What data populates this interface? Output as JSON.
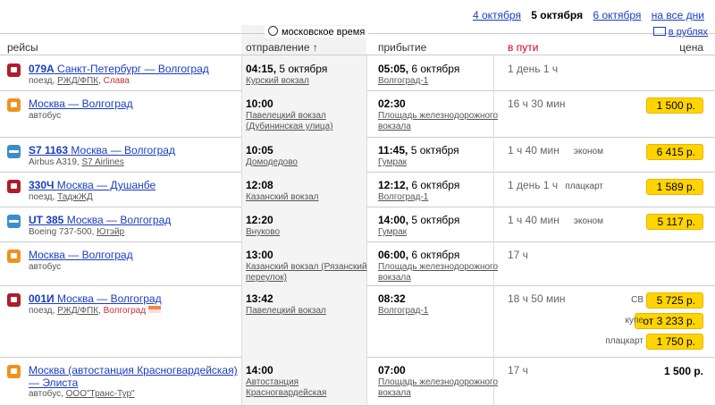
{
  "dates": {
    "prev": "4 октября",
    "current": "5 октября",
    "next": "6 октября",
    "all": "на все дни"
  },
  "header": {
    "moscow_time": "московское время",
    "currency": "в рублях",
    "col_route": "рейсы",
    "col_departure": "отправление ↑",
    "col_arrival": "прибытие",
    "col_duration": "в пути",
    "col_price": "цена"
  },
  "rows": [
    {
      "type": "train",
      "number": "079А",
      "route": "Санкт-Петербург — Волгоград",
      "kind": "поезд,",
      "carrier": "РЖД/ФПК",
      "brand": "Слава",
      "dep_time": "04:15",
      "dep_date": "5 октября",
      "dep_station": "Курский вокзал",
      "arr_time": "05:05",
      "arr_date": "6 октября",
      "arr_station": "Волгоград-1",
      "duration": "1 день 1 ч",
      "prices": []
    },
    {
      "type": "bus",
      "number": "",
      "route": "Москва — Волгоград",
      "kind": "автобус",
      "carrier": "",
      "brand": "",
      "dep_time": "10:00",
      "dep_date": "",
      "dep_station": "Павелецкий вокзал (Дубининская улица)",
      "arr_time": "02:30",
      "arr_date": "",
      "arr_station": "Площадь железнодорожного вокзала",
      "duration": "16 ч 30 мин",
      "prices": [
        {
          "class": "",
          "value": "1 500 р."
        }
      ]
    },
    {
      "type": "plane",
      "number": "S7 1163",
      "route": "Москва — Волгоград",
      "kind": "Airbus A319,",
      "carrier": "S7 Airlines",
      "brand": "",
      "dep_time": "10:05",
      "dep_date": "",
      "dep_station": "Домодедово",
      "arr_time": "11:45",
      "arr_date": "5 октября",
      "arr_station": "Гумрак",
      "duration": "1 ч 40 мин",
      "prices": [
        {
          "class": "эконом",
          "value": "6 415 р."
        }
      ]
    },
    {
      "type": "train",
      "number": "330Ч",
      "route": "Москва — Душанбе",
      "kind": "поезд,",
      "carrier": "ТаджЖД",
      "brand": "",
      "dep_time": "12:08",
      "dep_date": "",
      "dep_station": "Казанский вокзал",
      "arr_time": "12:12",
      "arr_date": "6 октября",
      "arr_station": "Волгоград-1",
      "duration": "1 день 1 ч",
      "prices": [
        {
          "class": "плацкарт",
          "value": "1 589 р."
        }
      ]
    },
    {
      "type": "plane",
      "number": "UT 385",
      "route": "Москва — Волгоград",
      "kind": "Boeing 737-500,",
      "carrier": "Ютэйр",
      "brand": "",
      "dep_time": "12:20",
      "dep_date": "",
      "dep_station": "Внуково",
      "arr_time": "14:00",
      "arr_date": "5 октября",
      "arr_station": "Гумрак",
      "duration": "1 ч 40 мин",
      "prices": [
        {
          "class": "эконом",
          "value": "5 117 р."
        }
      ]
    },
    {
      "type": "bus",
      "number": "",
      "route": "Москва — Волгоград",
      "kind": "автобус",
      "carrier": "",
      "brand": "",
      "dep_time": "13:00",
      "dep_date": "",
      "dep_station": "Казанский вокзал (Рязанский переулок)",
      "arr_time": "06:00",
      "arr_date": "6 октября",
      "arr_station": "Площадь железнодорожного вокзала",
      "duration": "17 ч",
      "prices": []
    },
    {
      "type": "train",
      "number": "001И",
      "route": "Москва — Волгоград",
      "kind": "поезд,",
      "carrier": "РЖД/ФПК",
      "brand": "Волгоград",
      "dep_time": "13:42",
      "dep_date": "",
      "dep_station": "Павелецкий вокзал",
      "arr_time": "08:32",
      "arr_date": "",
      "arr_station": "Волгоград-1",
      "duration": "18 ч 50 мин",
      "prices": [
        {
          "class": "СВ",
          "value": "5 725 р."
        },
        {
          "class": "купе",
          "value": "от 3 233 р."
        },
        {
          "class": "плацкарт",
          "value": "1 750 р."
        }
      ]
    },
    {
      "type": "bus",
      "number": "",
      "route": "Москва (автостанция Красногвардейская) — Элиста",
      "kind": "автобус,",
      "carrier": "ООО\"Транс-Тур\"",
      "brand": "",
      "dep_time": "14:00",
      "dep_date": "",
      "dep_station": "Автостанция Красногвардейская",
      "arr_time": "07:00",
      "arr_date": "",
      "arr_station": "Площадь железнодорожного вокзала",
      "duration": "17 ч",
      "prices": [
        {
          "class": "",
          "value": "1 500 р."
        }
      ]
    }
  ]
}
